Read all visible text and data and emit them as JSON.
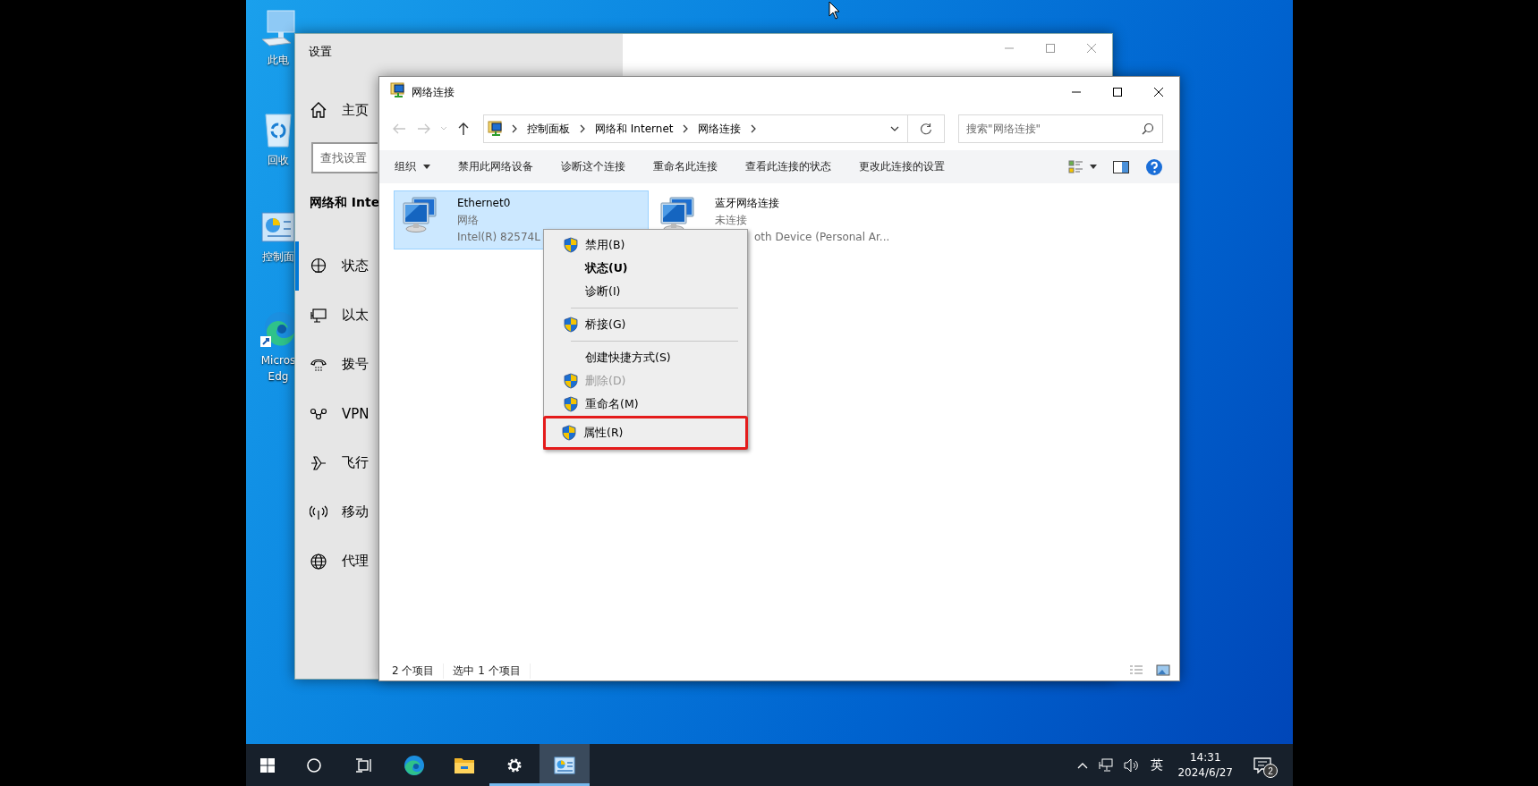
{
  "desktop_icons": [
    {
      "label": "此电"
    },
    {
      "label": "回收"
    },
    {
      "label": "控制面"
    },
    {
      "label": "Micros\nEdg"
    }
  ],
  "settings_window": {
    "title": "设置",
    "home": "主页",
    "search": {
      "placeholder": "查找设置"
    },
    "heading": "网络和 Inte",
    "nav": [
      {
        "label": "状态",
        "selected": true
      },
      {
        "label": "以太",
        "selected": false
      },
      {
        "label": "拨号",
        "selected": false
      },
      {
        "label": "VPN",
        "selected": false
      },
      {
        "label": "飞行",
        "selected": false
      },
      {
        "label": "移动",
        "selected": false
      },
      {
        "label": "代理",
        "selected": false
      }
    ]
  },
  "explorer_window": {
    "title": "网络连接",
    "breadcrumb": [
      "控制面板",
      "网络和 Internet",
      "网络连接"
    ],
    "search": {
      "placeholder": "搜索\"网络连接\""
    },
    "commands": [
      "组织",
      "禁用此网络设备",
      "诊断这个连接",
      "重命名此连接",
      "查看此连接的状态",
      "更改此连接的设置"
    ],
    "items": [
      {
        "name": "Ethernet0",
        "status": "网络",
        "device": "Intel(R) 82574L",
        "selected": true
      },
      {
        "name": "蓝牙网络连接",
        "status": "未连接",
        "device": "oth Device (Personal Ar...",
        "selected": false
      }
    ],
    "status_bar": [
      "2 个项目",
      "选中 1 个项目"
    ]
  },
  "context_menu": [
    {
      "kind": "item",
      "label": "禁用(B)",
      "shield": true,
      "default": false,
      "disabled": false,
      "highlighted": false
    },
    {
      "kind": "item",
      "label": "状态(U)",
      "shield": false,
      "default": true,
      "disabled": false,
      "highlighted": false
    },
    {
      "kind": "item",
      "label": "诊断(I)",
      "shield": false,
      "default": false,
      "disabled": false,
      "highlighted": false
    },
    {
      "kind": "separator"
    },
    {
      "kind": "item",
      "label": "桥接(G)",
      "shield": true,
      "default": false,
      "disabled": false,
      "highlighted": false
    },
    {
      "kind": "separator"
    },
    {
      "kind": "item",
      "label": "创建快捷方式(S)",
      "shield": false,
      "default": false,
      "disabled": false,
      "highlighted": false
    },
    {
      "kind": "item",
      "label": "删除(D)",
      "shield": true,
      "default": false,
      "disabled": true,
      "highlighted": false
    },
    {
      "kind": "item",
      "label": "重命名(M)",
      "shield": true,
      "default": false,
      "disabled": false,
      "highlighted": false
    },
    {
      "kind": "item",
      "label": "属性(R)",
      "shield": true,
      "default": false,
      "disabled": false,
      "highlighted": true
    }
  ],
  "taskbar": {
    "apps": [
      {
        "kind": "start",
        "running": false,
        "selected": false
      },
      {
        "kind": "search",
        "running": false,
        "selected": false
      },
      {
        "kind": "task-view",
        "running": false,
        "selected": false
      },
      {
        "kind": "browser",
        "running": false,
        "selected": false
      },
      {
        "kind": "files",
        "running": false,
        "selected": false
      },
      {
        "kind": "settings",
        "running": true,
        "selected": false
      },
      {
        "kind": "control-panel",
        "running": true,
        "selected": true
      }
    ],
    "ime": "英",
    "time": "14:31",
    "date": "2024/6/27",
    "notification_count": "2"
  }
}
